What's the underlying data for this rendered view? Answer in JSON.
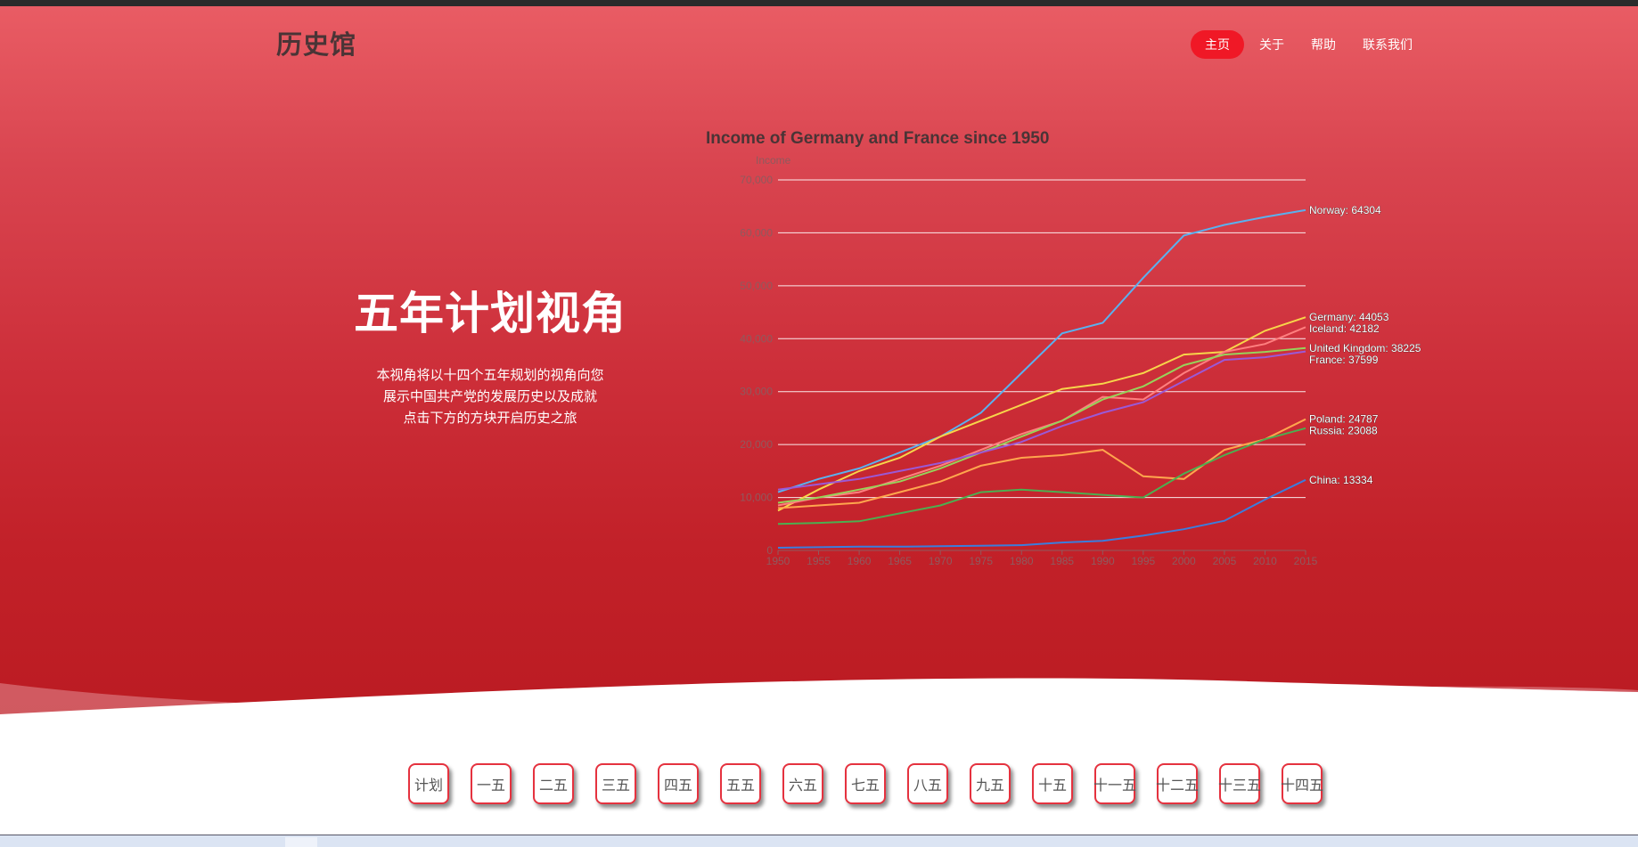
{
  "header": {
    "logo": "历史馆",
    "nav": [
      {
        "label": "主页",
        "active": true
      },
      {
        "label": "关于",
        "active": false
      },
      {
        "label": "帮助",
        "active": false
      },
      {
        "label": "联系我们",
        "active": false
      }
    ]
  },
  "hero": {
    "title": "五年计划视角",
    "desc_lines": [
      "本视角将以十四个五年规划的视角向您",
      "展示中国共产党的发展历史以及成就",
      "点击下方的方块开启历史之旅"
    ]
  },
  "plan_buttons": [
    "计划",
    "一五",
    "二五",
    "三五",
    "四五",
    "五五",
    "六五",
    "七五",
    "八五",
    "九五",
    "十五",
    "十一五",
    "十二五",
    "十三五",
    "十四五"
  ],
  "chart_data": {
    "type": "line",
    "title": "Income of Germany and France since 1950",
    "ylabel": "Income",
    "xlabel": "",
    "x": [
      1950,
      1955,
      1960,
      1965,
      1970,
      1975,
      1980,
      1985,
      1990,
      1995,
      2000,
      2005,
      2010,
      2015
    ],
    "ylim": [
      0,
      70000
    ],
    "yticks": [
      0,
      10000,
      20000,
      30000,
      40000,
      50000,
      60000,
      70000
    ],
    "ytick_labels": [
      "0",
      "10,000",
      "20,000",
      "30,000",
      "40,000",
      "50,000",
      "60,000",
      "70,000"
    ],
    "xticks": [
      1950,
      1955,
      1960,
      1965,
      1970,
      1975,
      1980,
      1985,
      1990,
      1995,
      2000,
      2005,
      2010,
      2015
    ],
    "grid": true,
    "series": [
      {
        "name": "Norway",
        "color": "#5ab1ef",
        "end_label": "Norway: 64304",
        "values": [
          11000,
          13500,
          15500,
          18500,
          21500,
          26000,
          33500,
          41000,
          43000,
          51500,
          59500,
          61500,
          63000,
          64304
        ]
      },
      {
        "name": "Germany",
        "color": "#f7d54a",
        "end_label": "Germany: 44053",
        "values": [
          7500,
          11500,
          15000,
          17500,
          21500,
          24500,
          27500,
          30500,
          31500,
          33500,
          37000,
          37500,
          41500,
          44053
        ]
      },
      {
        "name": "Iceland",
        "color": "#ff7f7f",
        "end_label": "Iceland: 42182",
        "values": [
          8500,
          10000,
          11000,
          13500,
          16000,
          19000,
          22000,
          24500,
          29000,
          28500,
          33500,
          37500,
          39000,
          42182
        ]
      },
      {
        "name": "United Kingdom",
        "color": "#97d35a",
        "end_label": "United Kingdom: 38225",
        "values": [
          9000,
          10000,
          11500,
          13000,
          15500,
          18500,
          21500,
          24500,
          28500,
          31000,
          35000,
          37000,
          37500,
          38225
        ]
      },
      {
        "name": "France",
        "color": "#9b59d6",
        "end_label": "France: 37599",
        "values": [
          11500,
          12500,
          13500,
          15000,
          16500,
          18500,
          20500,
          23500,
          26000,
          28000,
          32000,
          36000,
          36500,
          37599
        ]
      },
      {
        "name": "Poland",
        "color": "#ffa64d",
        "end_label": "Poland: 24787",
        "values": [
          8000,
          8500,
          9000,
          11000,
          13000,
          16000,
          17500,
          18000,
          19000,
          14000,
          13500,
          19000,
          21000,
          24787
        ]
      },
      {
        "name": "Russia",
        "color": "#4caf50",
        "end_label": "Russia: 23088",
        "values": [
          5000,
          5200,
          5500,
          7000,
          8500,
          11000,
          11500,
          11000,
          10500,
          10000,
          14500,
          18000,
          21000,
          23088
        ]
      },
      {
        "name": "China",
        "color": "#3b7ddd",
        "end_label": "China: 13334",
        "values": [
          500,
          600,
          700,
          700,
          800,
          900,
          1000,
          1500,
          1800,
          2800,
          4000,
          5600,
          9600,
          13334
        ]
      }
    ]
  }
}
